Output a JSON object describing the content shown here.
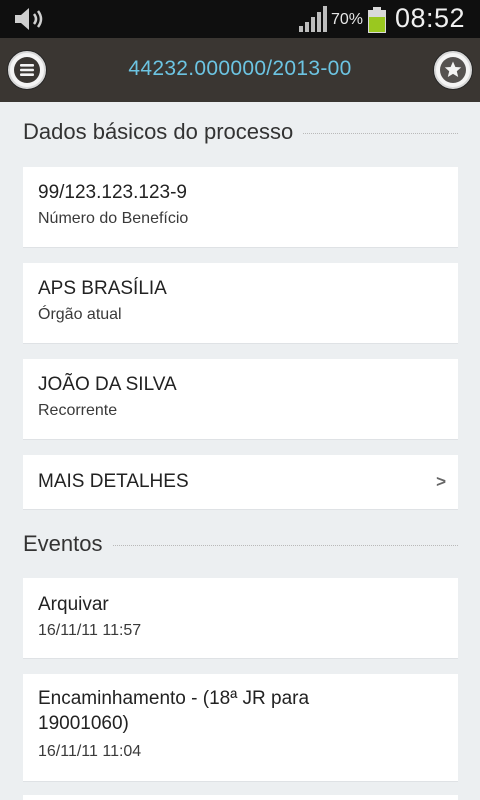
{
  "status_bar": {
    "volume_icon": "volume-icon",
    "signal_icon": "signal-bars-icon",
    "battery_percent": "70%",
    "battery_icon": "battery-icon",
    "time": "08:52"
  },
  "app_bar": {
    "menu_icon": "menu-icon",
    "title": "44232.000000/2013-00",
    "favorite_icon": "star-icon"
  },
  "colors": {
    "app_bar_bg": "#3a3632",
    "title_text": "#6cc4e2",
    "battery_green": "#9ac81f",
    "page_bg": "#eceff1"
  },
  "basic_data": {
    "heading": "Dados básicos do processo",
    "items": [
      {
        "value": "99/123.123.123-9",
        "label": "Número do Benefício"
      },
      {
        "value": "APS BRASÍLIA",
        "label": "Órgão atual"
      },
      {
        "value": "JOÃO DA SILVA",
        "label": "Recorrente"
      }
    ],
    "more_details": {
      "label": "MAIS DETALHES",
      "arrow": ">"
    }
  },
  "events": {
    "heading": "Eventos",
    "items": [
      {
        "title": "Arquivar",
        "date": "16/11/11 11:57"
      },
      {
        "title_line1": "Encaminhamento - (18ª JR para",
        "title_line2": "19001060)",
        "date": "16/11/11 11:04"
      }
    ]
  }
}
